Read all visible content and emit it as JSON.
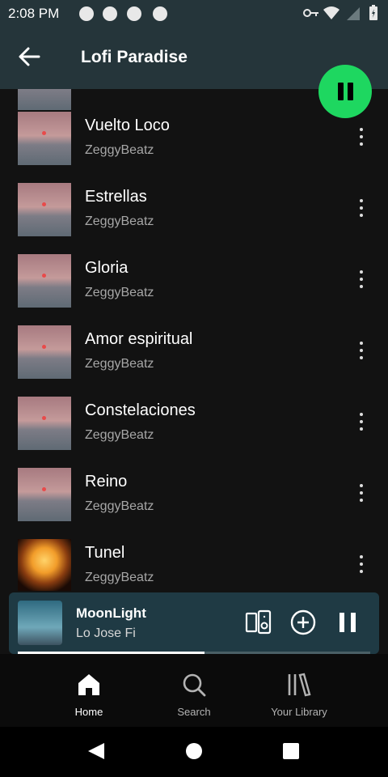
{
  "status_bar": {
    "time": "2:08 PM"
  },
  "header": {
    "title": "Lofi Paradise"
  },
  "colors": {
    "accent": "#1ed760",
    "header_bg": "#25353a",
    "mini_bg": "#1f3a44"
  },
  "tracks": [
    {
      "title": "Vuelto Loco",
      "artist": "ZeggyBeatz",
      "art": "pink"
    },
    {
      "title": "Estrellas",
      "artist": "ZeggyBeatz",
      "art": "pink"
    },
    {
      "title": "Gloria",
      "artist": "ZeggyBeatz",
      "art": "pink"
    },
    {
      "title": "Amor espiritual",
      "artist": "ZeggyBeatz",
      "art": "pink"
    },
    {
      "title": "Constelaciones",
      "artist": "ZeggyBeatz",
      "art": "pink"
    },
    {
      "title": "Reino",
      "artist": "ZeggyBeatz",
      "art": "pink"
    },
    {
      "title": "Tunel",
      "artist": "ZeggyBeatz",
      "art": "sun"
    }
  ],
  "now_playing": {
    "title": "MoonLight",
    "artist": "Lo Jose Fi",
    "progress": 0.53
  },
  "nav": {
    "home": "Home",
    "search": "Search",
    "library": "Your Library"
  }
}
